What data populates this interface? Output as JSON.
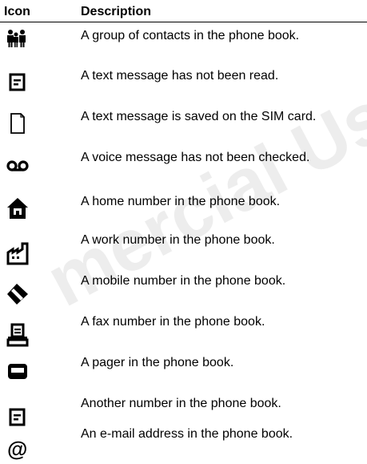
{
  "header": {
    "icon_label": "Icon",
    "description_label": "Description"
  },
  "rows": [
    {
      "icon": "group-icon",
      "description": "A group of contacts in the phone book."
    },
    {
      "icon": "unread-message-icon",
      "description": "A text message has not been read."
    },
    {
      "icon": "sim-card-icon",
      "description": "A text message is saved on the SIM card."
    },
    {
      "icon": "voicemail-icon",
      "description": "A voice message has not been checked."
    },
    {
      "icon": "home-icon",
      "description": "A home number in the phone book."
    },
    {
      "icon": "work-icon",
      "description": "A work number in the phone book."
    },
    {
      "icon": "mobile-icon",
      "description": "A mobile number in the phone book."
    },
    {
      "icon": "fax-icon",
      "description": "A fax number in the phone book."
    },
    {
      "icon": "pager-icon",
      "description": "A pager in the phone book."
    },
    {
      "icon": "other-number-icon",
      "description": "Another number in the phone book."
    },
    {
      "icon": "email-icon",
      "description": "An e-mail address in the phone book."
    }
  ]
}
